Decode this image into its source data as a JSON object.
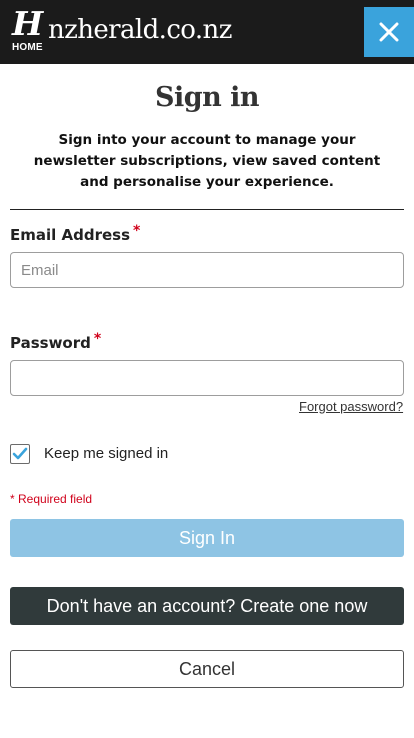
{
  "header": {
    "logo_letter": "H",
    "home_label": "HOME",
    "site_name": "nzherald.co.nz",
    "background_color": "#1b1b1b",
    "close_button_color": "#3aa3dc",
    "close_icon": "close-icon"
  },
  "form": {
    "title": "Sign in",
    "intro": "Sign into your account to manage your newsletter subscriptions, view saved content and personalise your experience.",
    "email": {
      "label": "Email Address",
      "required_marker": "*",
      "value": "",
      "placeholder": "Email"
    },
    "password": {
      "label": "Password",
      "required_marker": "*",
      "value": "",
      "placeholder": ""
    },
    "forgot_password": "Forgot password?",
    "keep_signed_in": {
      "label": "Keep me signed in",
      "checked": true,
      "check_color": "#3aa3dc"
    },
    "required_note": "* Required field",
    "required_color": "#d0021b",
    "sign_in_button": "Sign In",
    "create_account_button": "Don't have an account? Create one now",
    "cancel_button": "Cancel"
  }
}
